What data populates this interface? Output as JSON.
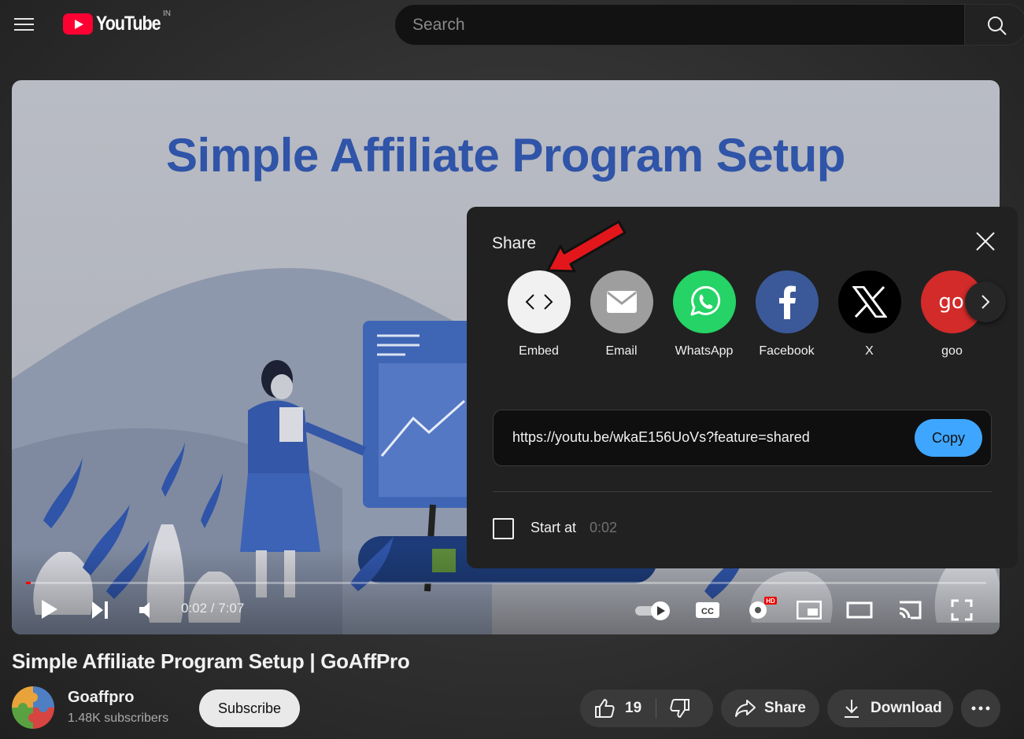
{
  "header": {
    "logo_text": "YouTube",
    "region": "IN",
    "search_placeholder": "Search"
  },
  "video": {
    "thumbnail_title": "Simple Affiliate Program Setup",
    "time": "0:02 / 7:07",
    "progress": 0.005
  },
  "watch": {
    "title": "Simple Affiliate Program Setup | GoAffPro",
    "channel_name": "Goaffpro",
    "subscribers": "1.48K subscribers",
    "subscribe_label": "Subscribe",
    "like_count": "19",
    "share_label": "Share",
    "download_label": "Download"
  },
  "share_dialog": {
    "title": "Share",
    "targets": [
      {
        "label": "Embed",
        "icon": "code-icon",
        "color": "#f1f1f1"
      },
      {
        "label": "Email",
        "icon": "mail-icon",
        "color": "#9e9e9e"
      },
      {
        "label": "WhatsApp",
        "icon": "whatsapp-icon",
        "color": "#25d366"
      },
      {
        "label": "Facebook",
        "icon": "facebook-icon",
        "color": "#3b5998"
      },
      {
        "label": "X",
        "icon": "x-icon",
        "color": "#000000"
      },
      {
        "label": "goo",
        "icon": "goo-icon",
        "color": "#d32a2a",
        "icon_text": "goo"
      }
    ],
    "url": "https://youtu.be/wkaE156UoVs?feature=shared",
    "copy_label": "Copy",
    "start_at_label": "Start at",
    "start_at_time": "0:02",
    "start_at_checked": false
  },
  "colors": {
    "accent": "#3ea6ff",
    "youtube_red": "#ff0033",
    "annotation_arrow": "#e3161c"
  }
}
